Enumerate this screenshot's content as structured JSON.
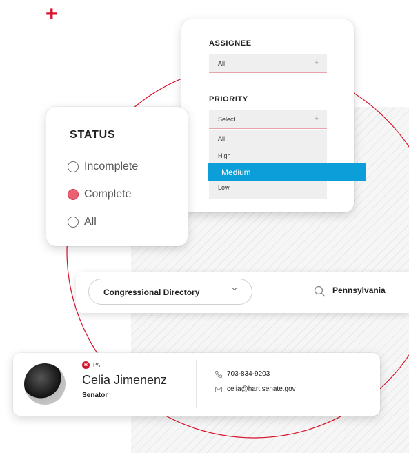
{
  "filter": {
    "assignee_label": "ASSIGNEE",
    "assignee_value": "All",
    "priority_label": "PRIORITY",
    "priority_value": "Select",
    "priority_options": [
      "All",
      "High",
      "Medium",
      "Low"
    ],
    "highlighted_option": "Medium"
  },
  "status": {
    "title": "STATUS",
    "options": [
      "Incomplete",
      "Complete",
      "All"
    ],
    "selected": "Complete"
  },
  "directory": {
    "dropdown_label": "Congressional Directory",
    "search_value": "Pennsylvania"
  },
  "profile": {
    "party": "R",
    "state": "PA",
    "name": "Celia Jimenenz",
    "role": "Senator",
    "phone": "703-834-9203",
    "email": "celia@hart.senate.gov"
  },
  "colors": {
    "accent_red": "#d7122b",
    "highlight_blue": "#0c9ed9",
    "radio_selected": "#ec6072"
  },
  "icons": {
    "add": "plus-icon",
    "dropdown": "chevron-down-icon",
    "search": "search-icon",
    "phone": "phone-icon",
    "email": "envelope-icon"
  }
}
